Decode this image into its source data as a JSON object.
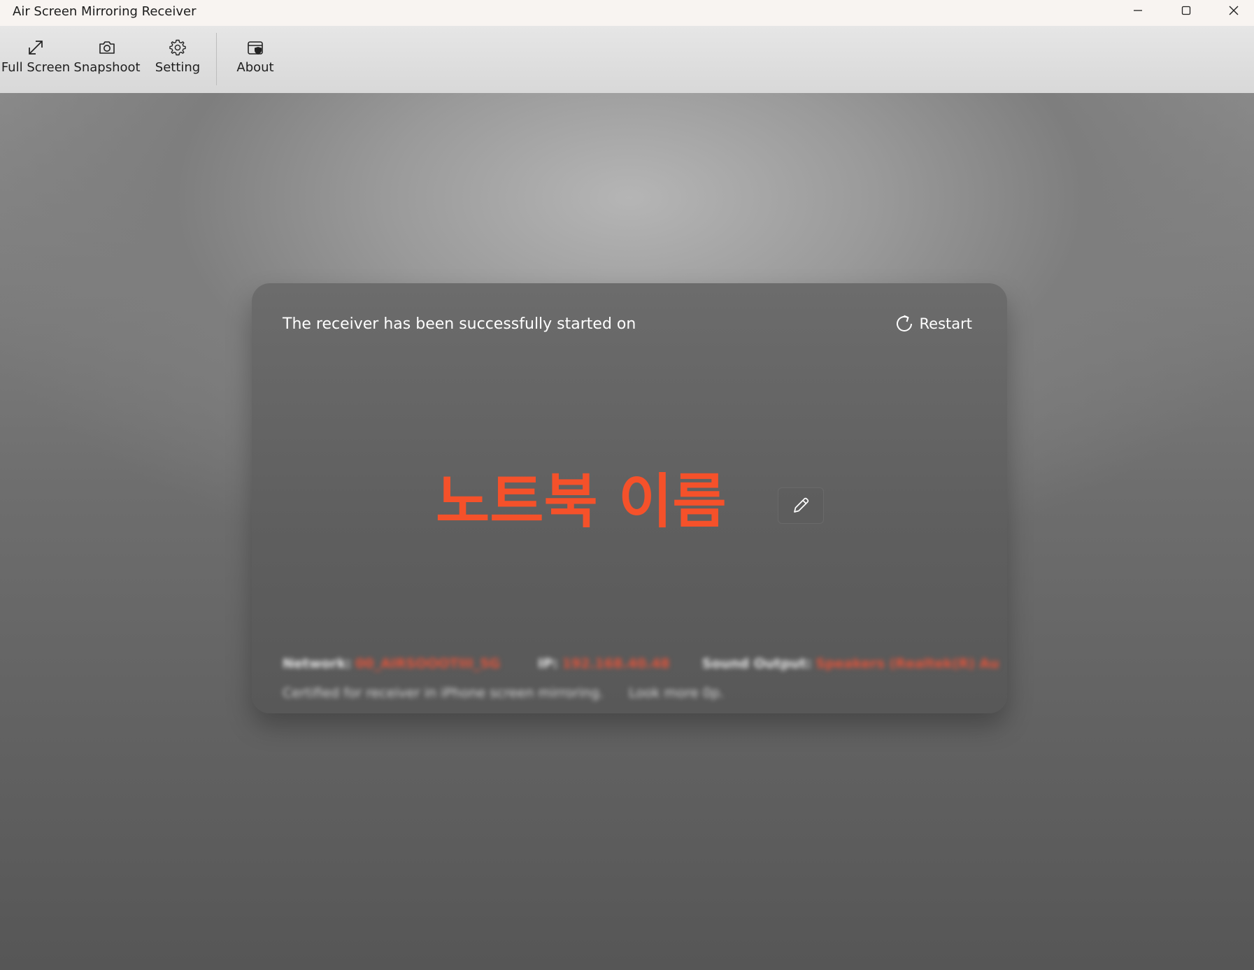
{
  "window": {
    "title": "Air Screen Mirroring Receiver"
  },
  "toolbar": {
    "full_screen": {
      "label": "Full Screen",
      "icon": "expand-arrows-icon"
    },
    "snapshot": {
      "label": "Snapshoot",
      "icon": "camera-icon"
    },
    "setting": {
      "label": "Setting",
      "icon": "gear-icon"
    },
    "about": {
      "label": "About",
      "icon": "wallet-shield-icon"
    }
  },
  "card": {
    "status_message": "The receiver has been successfully started on",
    "restart_label": "Restart",
    "device_name": "노트북 이름",
    "info": {
      "network_label": "Network:",
      "network_value": "00_AIRSOOOTIII_5G",
      "ip_label": "IP:",
      "ip_value": "192.168.40.48",
      "sound_label": "Sound Output:",
      "sound_value": "Speakers (Realtek(R) Au",
      "cert_text": "Certified for receiver in iPhone screen mirroring.",
      "more_text": "Look more 0p."
    }
  },
  "colors": {
    "accent": "#f5512a",
    "title_bar": "#f8f4f1",
    "toolbar": "#dedede",
    "card": "#626262"
  }
}
